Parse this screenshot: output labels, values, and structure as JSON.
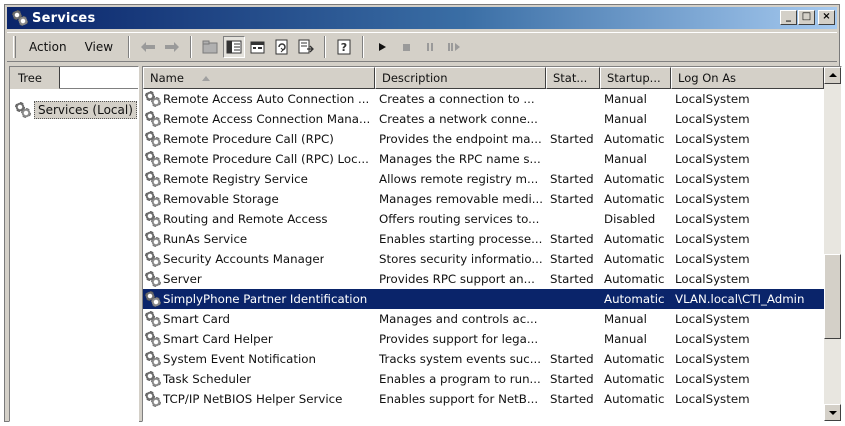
{
  "window": {
    "title": "Services",
    "minimize_label": "_",
    "maximize_label": "□",
    "close_label": "×"
  },
  "menu": {
    "action": "Action",
    "view": "View"
  },
  "toolbar": {
    "icons": [
      "back-arrow-icon",
      "forward-arrow-icon",
      "up-folder-icon",
      "show-hide-tree-icon",
      "properties-icon",
      "refresh-icon",
      "export-list-icon",
      "help-icon",
      "start-service-icon",
      "stop-service-icon",
      "pause-service-icon",
      "restart-service-icon"
    ]
  },
  "tree": {
    "tab_label": "Tree",
    "node_label": "Services (Local)"
  },
  "table": {
    "columns": [
      "Name",
      "Description",
      "Stat...",
      "Startup...",
      "Log On As"
    ],
    "rows": [
      {
        "name": "Remote Access Auto Connection ...",
        "description": "Creates a connection to ...",
        "status": "",
        "startup": "Manual",
        "logon": "LocalSystem"
      },
      {
        "name": "Remote Access Connection Mana...",
        "description": "Creates a network conne...",
        "status": "",
        "startup": "Manual",
        "logon": "LocalSystem"
      },
      {
        "name": "Remote Procedure Call (RPC)",
        "description": "Provides the endpoint ma...",
        "status": "Started",
        "startup": "Automatic",
        "logon": "LocalSystem"
      },
      {
        "name": "Remote Procedure Call (RPC) Loc...",
        "description": "Manages the RPC name s...",
        "status": "",
        "startup": "Manual",
        "logon": "LocalSystem"
      },
      {
        "name": "Remote Registry Service",
        "description": "Allows remote registry m...",
        "status": "Started",
        "startup": "Automatic",
        "logon": "LocalSystem"
      },
      {
        "name": "Removable Storage",
        "description": "Manages removable medi...",
        "status": "Started",
        "startup": "Automatic",
        "logon": "LocalSystem"
      },
      {
        "name": "Routing and Remote Access",
        "description": "Offers routing services to...",
        "status": "",
        "startup": "Disabled",
        "logon": "LocalSystem"
      },
      {
        "name": "RunAs Service",
        "description": "Enables starting processe...",
        "status": "Started",
        "startup": "Automatic",
        "logon": "LocalSystem"
      },
      {
        "name": "Security Accounts Manager",
        "description": "Stores security informatio...",
        "status": "Started",
        "startup": "Automatic",
        "logon": "LocalSystem"
      },
      {
        "name": "Server",
        "description": "Provides RPC support an...",
        "status": "Started",
        "startup": "Automatic",
        "logon": "LocalSystem"
      },
      {
        "name": "SimplyPhone Partner Identification",
        "description": "",
        "status": "",
        "startup": "Automatic",
        "logon": "VLAN.local\\CTI_Admin",
        "selected": true
      },
      {
        "name": "Smart Card",
        "description": "Manages and controls ac...",
        "status": "",
        "startup": "Manual",
        "logon": "LocalSystem"
      },
      {
        "name": "Smart Card Helper",
        "description": "Provides support for lega...",
        "status": "",
        "startup": "Manual",
        "logon": "LocalSystem"
      },
      {
        "name": "System Event Notification",
        "description": "Tracks system events suc...",
        "status": "Started",
        "startup": "Automatic",
        "logon": "LocalSystem"
      },
      {
        "name": "Task Scheduler",
        "description": "Enables a program to run...",
        "status": "Started",
        "startup": "Automatic",
        "logon": "LocalSystem"
      },
      {
        "name": "TCP/IP NetBIOS Helper Service",
        "description": "Enables support for NetB...",
        "status": "Started",
        "startup": "Automatic",
        "logon": "LocalSystem"
      }
    ]
  },
  "colors": {
    "titlebar_start": "#0a246a",
    "titlebar_end": "#a6caf0",
    "selection": "#0a246a",
    "chrome": "#d4d0c8"
  }
}
